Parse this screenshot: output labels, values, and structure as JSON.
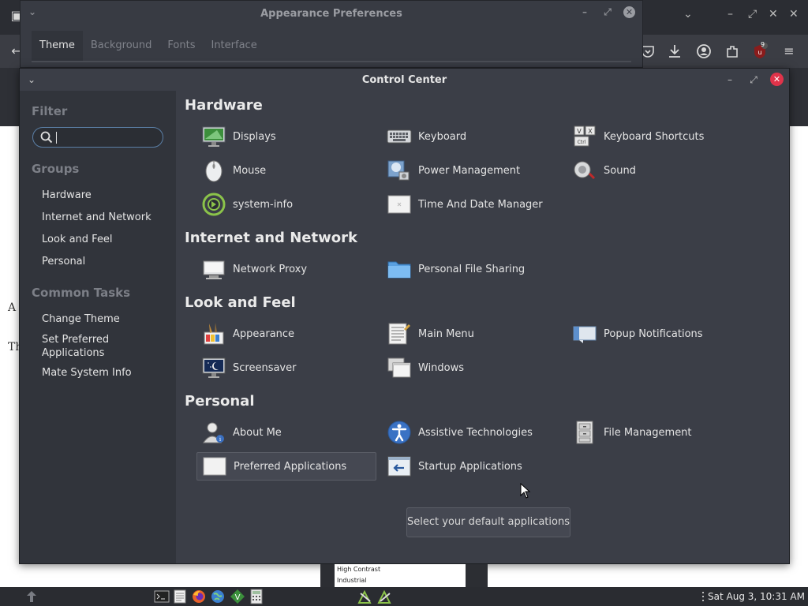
{
  "appearance_window": {
    "title": "Appearance Preferences",
    "tabs": [
      "Theme",
      "Background",
      "Fonts",
      "Interface"
    ]
  },
  "control_center": {
    "title": "Control Center",
    "sidebar": {
      "filter_heading": "Filter",
      "search_value": "",
      "groups_heading": "Groups",
      "groups": [
        "Hardware",
        "Internet and Network",
        "Look and Feel",
        "Personal"
      ],
      "tasks_heading": "Common Tasks",
      "tasks": [
        "Change Theme",
        "Set Preferred Applications",
        "Mate System Info"
      ]
    },
    "sections": [
      {
        "title": "Hardware",
        "items": [
          "Displays",
          "Keyboard",
          "Keyboard Shortcuts",
          "Mouse",
          "Power Management",
          "Sound",
          "system-info",
          "Time And Date Manager"
        ]
      },
      {
        "title": "Internet and Network",
        "items": [
          "Network Proxy",
          "Personal File Sharing"
        ]
      },
      {
        "title": "Look and Feel",
        "items": [
          "Appearance",
          "Main Menu",
          "Popup Notifications",
          "Screensaver",
          "Windows"
        ]
      },
      {
        "title": "Personal",
        "items": [
          "About Me",
          "Assistive Technologies",
          "File Management",
          "Preferred Applications",
          "Startup Applications"
        ]
      }
    ],
    "tooltip": "Select your default applications"
  },
  "background_page": {
    "letters": [
      "A",
      "Th"
    ],
    "list_items": [
      "High Contrast",
      "Industrial"
    ],
    "extension_badge": "9"
  },
  "panel": {
    "clock": "Sat Aug  3, 10:31 AM"
  },
  "colors": {
    "window_bg": "#3b3e47",
    "sidebar_bg": "#31343b",
    "close_red": "#e0334a",
    "search_border": "#5b7fa6"
  }
}
